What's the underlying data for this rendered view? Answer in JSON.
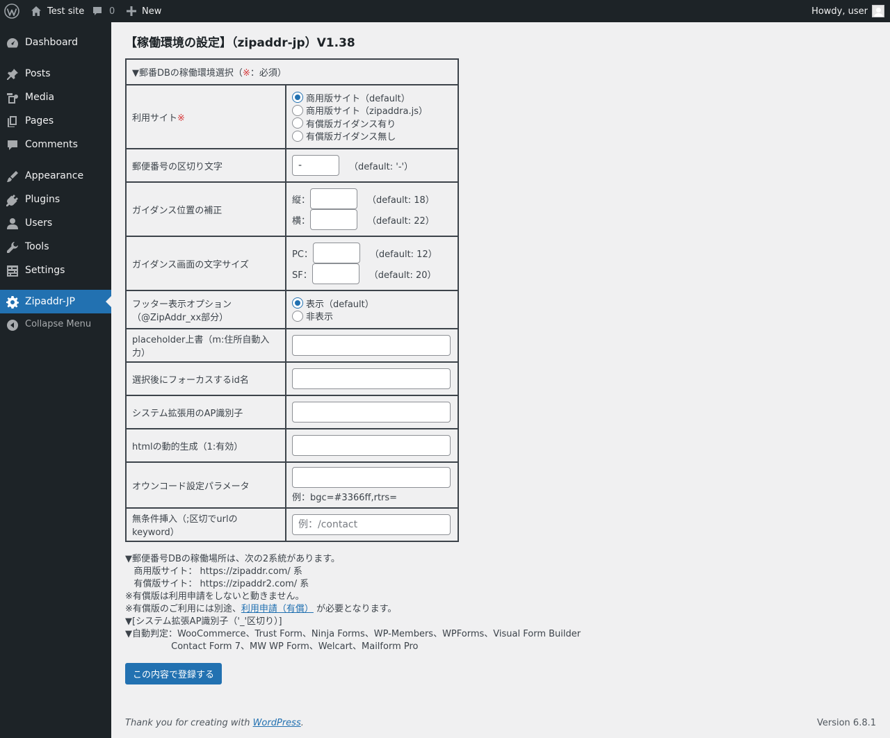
{
  "adminbar": {
    "site_name": "Test site",
    "comments_count": "0",
    "new_label": "New",
    "howdy": "Howdy, user"
  },
  "sidebar": {
    "items": [
      {
        "label": "Dashboard",
        "icon": "dashboard-icon"
      },
      {
        "label": "Posts",
        "icon": "pin-icon"
      },
      {
        "label": "Media",
        "icon": "media-icon"
      },
      {
        "label": "Pages",
        "icon": "pages-icon"
      },
      {
        "label": "Comments",
        "icon": "comment-icon"
      },
      {
        "label": "Appearance",
        "icon": "brush-icon"
      },
      {
        "label": "Plugins",
        "icon": "plug-icon"
      },
      {
        "label": "Users",
        "icon": "user-icon"
      },
      {
        "label": "Tools",
        "icon": "wrench-icon"
      },
      {
        "label": "Settings",
        "icon": "settings-sliders-icon"
      },
      {
        "label": "Zipaddr-JP",
        "icon": "gear-icon",
        "active": true
      },
      {
        "label": "Collapse Menu",
        "icon": "collapse-icon"
      }
    ]
  },
  "page": {
    "title": "【稼働環境の設定】（zipaddr-jp）V1.38",
    "table_header_prefix": "▼郵番DBの稼働環境選択（",
    "table_header_mark": "※",
    "table_header_suffix": "：必須）",
    "rows": {
      "site": {
        "label": "利用サイト",
        "mark": "※",
        "options": [
          "商用版サイト（default）",
          "商用版サイト（zipaddra.js）",
          "有償版ガイダンス有り",
          "有償版ガイダンス無し"
        ]
      },
      "separator": {
        "label": "郵便番号の区切り文字",
        "value": "-",
        "note": "（default: '-'）"
      },
      "position": {
        "label": "ガイダンス位置の補正",
        "v_label": "縦：",
        "v_note": "（default: 18）",
        "h_label": "横：",
        "h_note": "（default: 22）"
      },
      "fontsize": {
        "label": "ガイダンス画面の文字サイズ",
        "pc_label": "PC：",
        "pc_note": "（default: 12）",
        "sf_label": "SF：",
        "sf_note": "（default: 20）"
      },
      "footer": {
        "label_line1": "フッター表示オプション",
        "label_line2": "（@ZipAddr_xx部分）",
        "options": [
          "表示（default）",
          "非表示"
        ]
      },
      "placeholder": {
        "label": "placeholder上書（m:住所自動入力）"
      },
      "focus": {
        "label": "選択後にフォーカスするid名"
      },
      "ap_id": {
        "label": "システム拡張用のAP識別子"
      },
      "dynamic": {
        "label": "htmlの動的生成（1:有効）"
      },
      "own_code": {
        "label": "オウンコード設定パラメータ",
        "example": "例：bgc=#3366ff,rtrs="
      },
      "insert": {
        "label": "無条件挿入（;区切でurlのkeyword）",
        "placeholder": "例：/contact"
      }
    },
    "notes": {
      "line1": "▼郵便番号DBの稼働場所は、次の2系統があります。",
      "line2": "   商用版サイト： https://zipaddr.com/ 系",
      "line3": "   有償版サイト： https://zipaddr2.com/ 系",
      "line4": "※有償版は利用申請をしないと動きません。",
      "line5_prefix": "※有償版のご利用には別途、",
      "line5_link": "利用申請（有償）",
      "line5_suffix": " が必要となります。",
      "line6": "▼[システム拡張AP識別子（'_'区切り）]",
      "line7": "▼自動判定：WooCommerce、Trust Form、Ninja Forms、WP-Members、WPForms、Visual Form Builder",
      "line8": "                Contact Form 7、MW WP Form、Welcart、Mailform Pro"
    },
    "submit_label": "この内容で登録する"
  },
  "footer": {
    "thanks_prefix": "Thank you for creating with ",
    "thanks_link": "WordPress",
    "thanks_suffix": ".",
    "version": "Version 6.8.1"
  },
  "colors": {
    "admin_bg": "#1d2327",
    "accent": "#2271b1",
    "page_bg": "#f0f0f1",
    "required": "#d63638"
  }
}
